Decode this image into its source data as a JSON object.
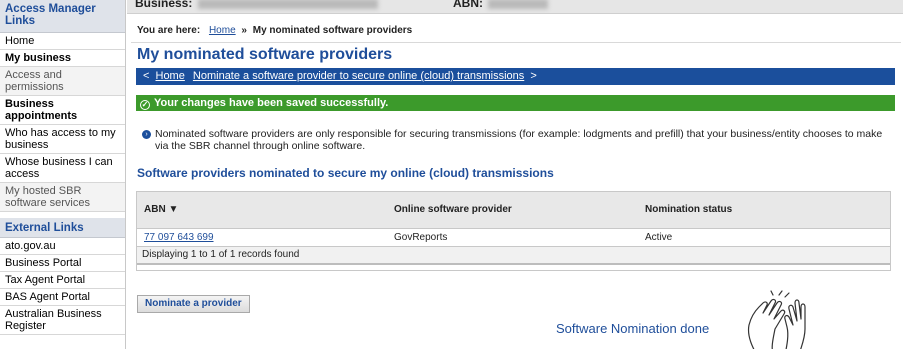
{
  "sidebar": {
    "section1_title": "Access Manager Links",
    "items": [
      {
        "label": "Home"
      },
      {
        "label": "My business"
      },
      {
        "label": "Access and permissions"
      },
      {
        "label": "Business appointments"
      },
      {
        "label": "Who has access to my business"
      },
      {
        "label": "Whose business I can access"
      },
      {
        "label": "My hosted SBR software services"
      }
    ],
    "section2_title": "External Links",
    "external": [
      {
        "label": "ato.gov.au"
      },
      {
        "label": "Business Portal"
      },
      {
        "label": "Tax Agent Portal"
      },
      {
        "label": "BAS Agent Portal"
      },
      {
        "label": "Australian Business Register"
      }
    ]
  },
  "topbar": {
    "business_label": "Business:",
    "abn_label": "ABN:"
  },
  "breadcrumb": {
    "label": "You are here:",
    "home": "Home",
    "separator": "»",
    "current": "My nominated software providers"
  },
  "page": {
    "title": "My nominated software providers"
  },
  "navbar": {
    "back_chevron": "<",
    "home": "Home",
    "link": "Nominate a software provider to secure online (cloud) transmissions",
    "forward_chevron": ">"
  },
  "success": {
    "icon": "✓",
    "message": "Your changes have been saved successfully."
  },
  "info": {
    "text": "Nominated software providers are only responsible for securing transmissions (for example: lodgments and prefill) that your business/entity chooses to make via the SBR channel through online software."
  },
  "section": {
    "title": "Software providers nominated to secure my online (cloud) transmissions"
  },
  "table": {
    "headers": [
      "ABN ▼",
      "Online software provider",
      "Nomination status"
    ],
    "rows": [
      [
        "77 097 643 699",
        "GovReports",
        "Active"
      ]
    ],
    "footer": "Displaying 1 to 1 of 1 records found"
  },
  "buttons": {
    "nominate": "Nominate a provider"
  },
  "caption": {
    "done": "Software Nomination done"
  },
  "colors": {
    "brand_blue": "#1b4f9c",
    "success_green": "#3c9a2b"
  },
  "icons": {
    "success": "check-circle-icon",
    "info": "info-bullet-icon",
    "clap": "clapping-hands-icon"
  }
}
